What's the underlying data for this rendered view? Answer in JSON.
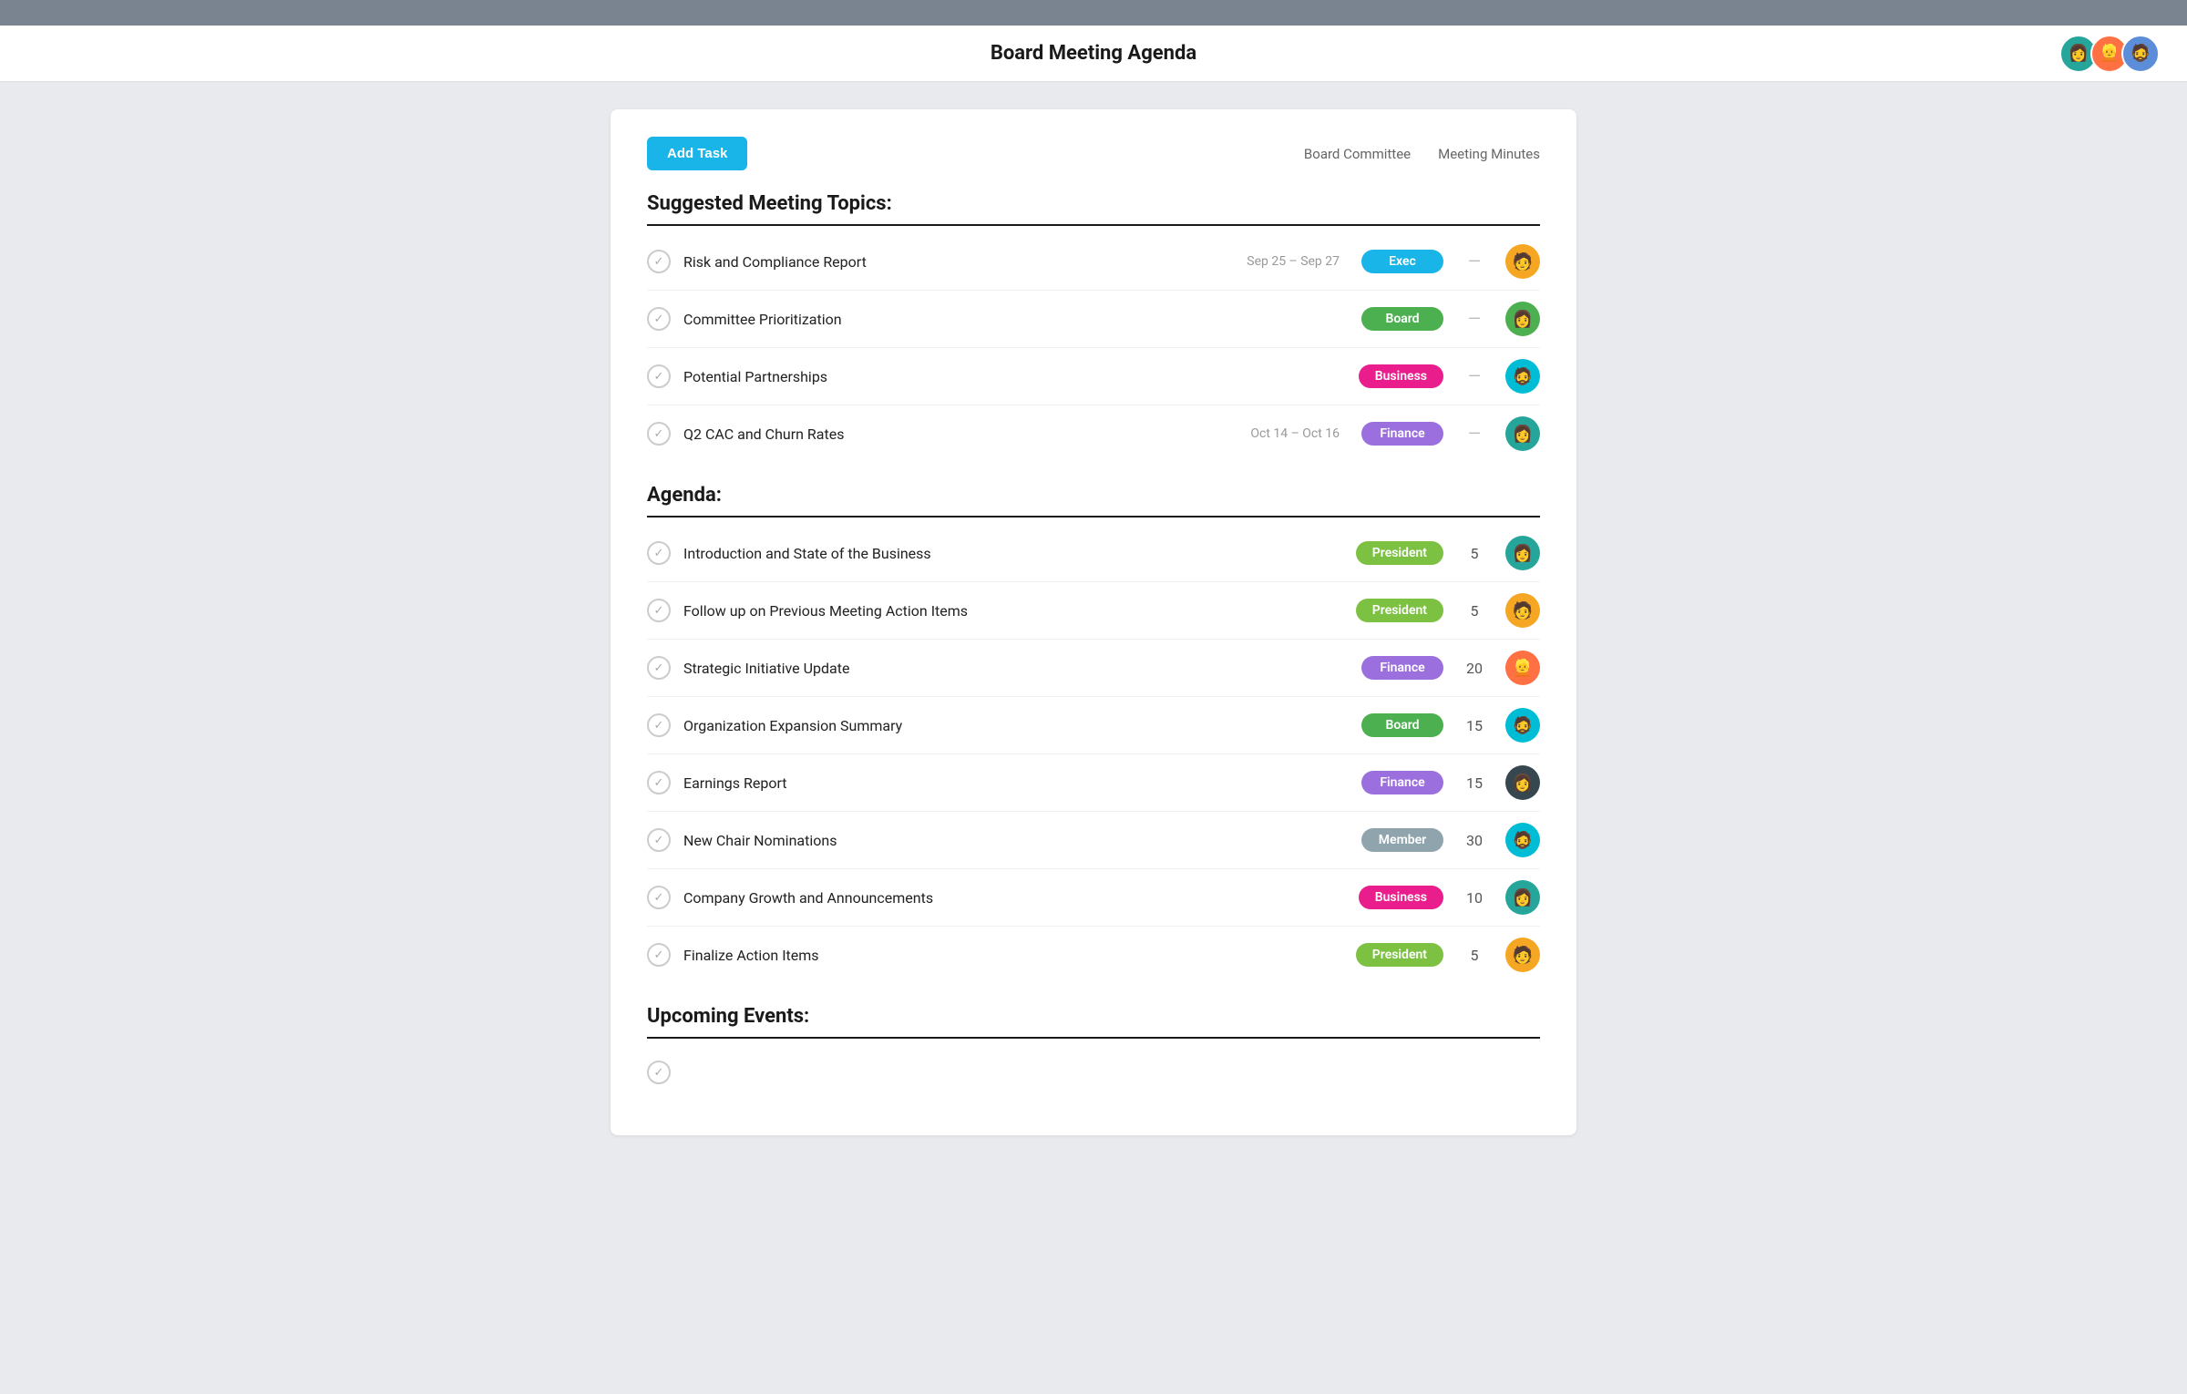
{
  "topBar": {},
  "header": {
    "title": "Board Meeting Agenda",
    "avatars": [
      {
        "id": 1,
        "emoji": "👩",
        "class": "av-teal"
      },
      {
        "id": 2,
        "emoji": "👱",
        "class": "av-orange"
      },
      {
        "id": 3,
        "emoji": "🧔",
        "class": "av-blue"
      }
    ]
  },
  "card": {
    "addTaskLabel": "Add Task",
    "navLinks": [
      {
        "label": "Board Committee"
      },
      {
        "label": "Meeting Minutes"
      }
    ]
  },
  "suggestedSection": {
    "title": "Suggested Meeting Topics:",
    "items": [
      {
        "name": "Risk and Compliance Report",
        "date": "Sep 25 – Sep 27",
        "tag": "Exec",
        "tagClass": "tag-exec",
        "minutes": "—",
        "avatarEmoji": "🧑",
        "avatarClass": "av-yellow"
      },
      {
        "name": "Committee Prioritization",
        "date": "",
        "tag": "Board",
        "tagClass": "tag-board",
        "minutes": "—",
        "avatarEmoji": "👩",
        "avatarClass": "av-green"
      },
      {
        "name": "Potential Partnerships",
        "date": "",
        "tag": "Business",
        "tagClass": "tag-business",
        "minutes": "—",
        "avatarEmoji": "🧔",
        "avatarClass": "av-cyan"
      },
      {
        "name": "Q2 CAC and Churn Rates",
        "date": "Oct 14 – Oct 16",
        "tag": "Finance",
        "tagClass": "tag-finance",
        "minutes": "—",
        "avatarEmoji": "👩",
        "avatarClass": "av-teal"
      }
    ]
  },
  "agendaSection": {
    "title": "Agenda:",
    "items": [
      {
        "name": "Introduction and State of the Business",
        "tag": "President",
        "tagClass": "tag-president",
        "minutes": "5",
        "avatarEmoji": "👩",
        "avatarClass": "av-teal"
      },
      {
        "name": "Follow up on Previous Meeting Action Items",
        "tag": "President",
        "tagClass": "tag-president",
        "minutes": "5",
        "avatarEmoji": "🧑",
        "avatarClass": "av-yellow"
      },
      {
        "name": "Strategic Initiative Update",
        "tag": "Finance",
        "tagClass": "tag-finance",
        "minutes": "20",
        "avatarEmoji": "👱",
        "avatarClass": "av-orange"
      },
      {
        "name": "Organization Expansion Summary",
        "tag": "Board",
        "tagClass": "tag-board",
        "minutes": "15",
        "avatarEmoji": "🧔",
        "avatarClass": "av-cyan"
      },
      {
        "name": "Earnings Report",
        "tag": "Finance",
        "tagClass": "tag-finance",
        "minutes": "15",
        "avatarEmoji": "👩",
        "avatarClass": "av-dark"
      },
      {
        "name": "New Chair Nominations",
        "tag": "Member",
        "tagClass": "tag-member",
        "minutes": "30",
        "avatarEmoji": "🧔",
        "avatarClass": "av-cyan"
      },
      {
        "name": "Company Growth and Announcements",
        "tag": "Business",
        "tagClass": "tag-business",
        "minutes": "10",
        "avatarEmoji": "👩",
        "avatarClass": "av-teal"
      },
      {
        "name": "Finalize Action Items",
        "tag": "President",
        "tagClass": "tag-president",
        "minutes": "5",
        "avatarEmoji": "🧑",
        "avatarClass": "av-yellow"
      }
    ]
  },
  "upcomingSection": {
    "title": "Upcoming Events:"
  }
}
